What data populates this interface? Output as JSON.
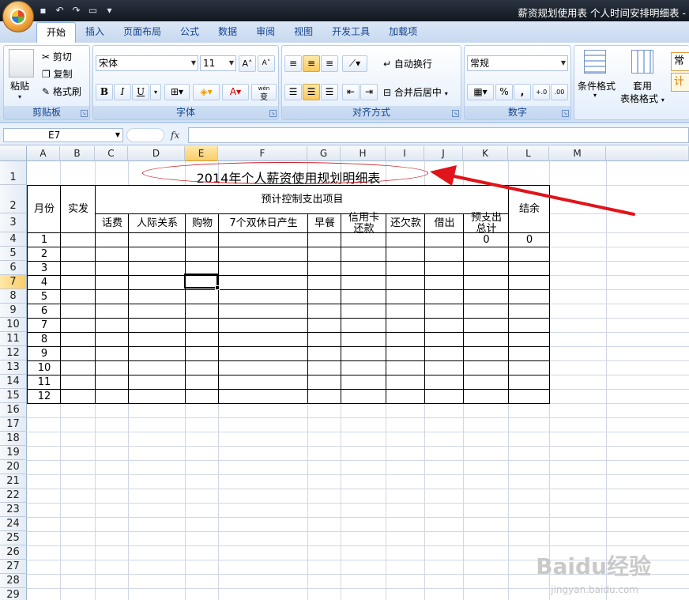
{
  "window": {
    "title": "薪资规划使用表  个人时间安排明细表 - "
  },
  "ribbon_tabs": [
    "开始",
    "插入",
    "页面布局",
    "公式",
    "数据",
    "审阅",
    "视图",
    "开发工具",
    "加载项"
  ],
  "clipboard": {
    "paste": "粘贴",
    "cut": "剪切",
    "copy": "复制",
    "format_painter": "格式刷",
    "label": "剪贴板"
  },
  "font": {
    "name": "宋体",
    "size": "11",
    "label": "字体",
    "bold": "B",
    "italic": "I",
    "underline": "U",
    "phonetic": "wén",
    "phonetic_char": "变"
  },
  "alignment": {
    "wrap_text": "自动换行",
    "merge_center": "合并后居中",
    "label": "对齐方式"
  },
  "number": {
    "format": "常规",
    "percent": "%",
    "comma": ",",
    "label": "数字",
    "inc_decimal": "+.0",
    "dec_decimal": ".00"
  },
  "styles": {
    "conditional": "条件格式",
    "table_format_1": "套用",
    "table_format_2": "表格格式",
    "cell_style_1": "常",
    "cell_style_2": "计"
  },
  "formula_bar": {
    "name_box": "E7",
    "fx": "fx"
  },
  "columns": [
    "A",
    "B",
    "C",
    "D",
    "E",
    "F",
    "G",
    "H",
    "I",
    "J",
    "K",
    "L",
    "M"
  ],
  "active_column": "E",
  "active_row": "7",
  "rows": [
    "1",
    "2",
    "3",
    "4",
    "5",
    "6",
    "7",
    "8",
    "9",
    "10",
    "11",
    "12",
    "13",
    "14",
    "15",
    "16",
    "17",
    "18",
    "19",
    "20",
    "21",
    "22",
    "23",
    "24",
    "25",
    "26",
    "27",
    "28",
    "29"
  ],
  "table": {
    "title": "2014年个人薪资使用规划明细表",
    "month_header": "月份",
    "actual_pay_header": "实发",
    "group_header": "预计控制支出项目",
    "expense_headers": [
      "话费",
      "人际关系",
      "购物",
      "7个双休日产生",
      "早餐",
      "信用卡\n还款",
      "还欠款",
      "借出",
      "预支出\n总计"
    ],
    "balance_header": "结余",
    "months": [
      "1",
      "2",
      "3",
      "4",
      "5",
      "6",
      "7",
      "8",
      "9",
      "10",
      "11",
      "12"
    ],
    "first_row_total": "0",
    "first_row_balance": "0"
  },
  "watermark": {
    "main": "Baidu经验",
    "sub": "jingyan.baidu.com"
  },
  "colors": {
    "arrow": "#e0141a",
    "ellipse": "#c9151c",
    "accent": "#15428b"
  }
}
